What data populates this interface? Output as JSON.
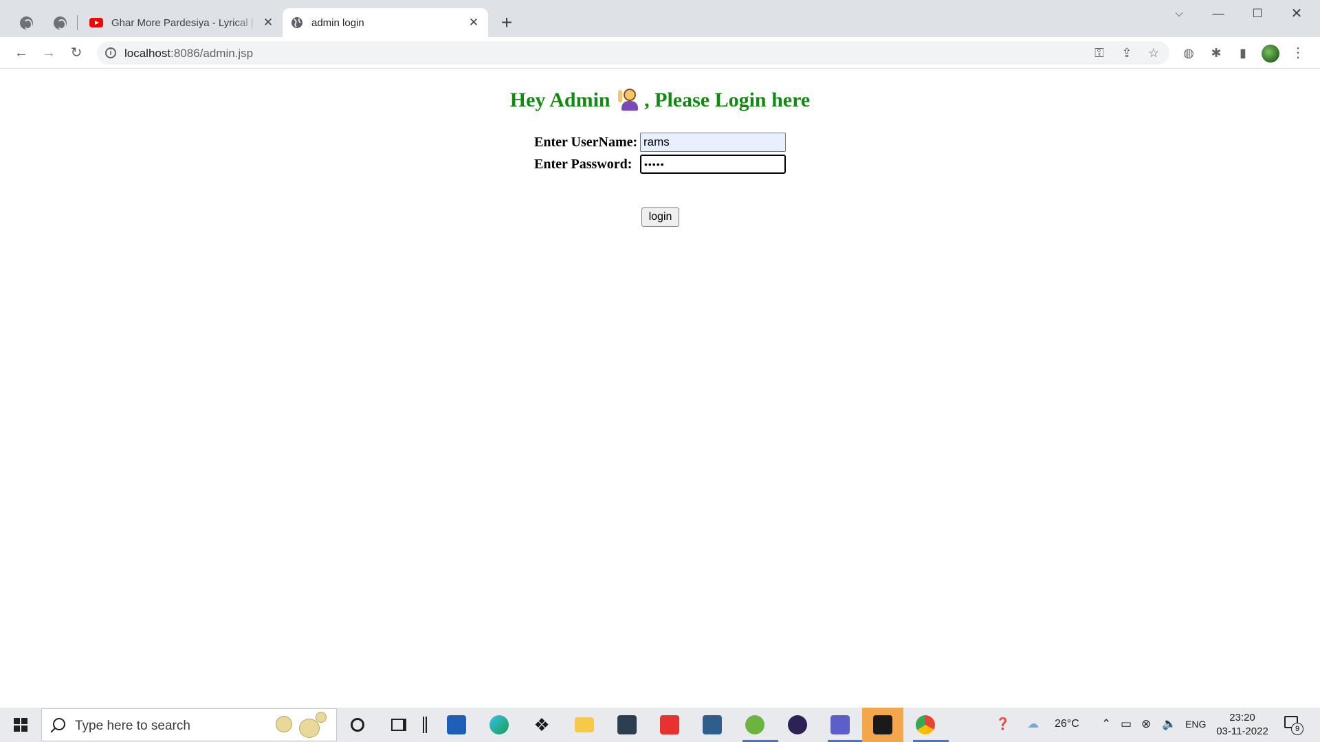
{
  "browser": {
    "tabs": [
      {
        "title": "Ghar More Pardesiya - Lyrical | Ka",
        "icon": "youtube-icon"
      },
      {
        "title": "admin login",
        "icon": "globe-icon"
      }
    ],
    "url_host": "localhost",
    "url_rest": ":8086/admin.jsp"
  },
  "page": {
    "heading_left": "Hey Admin",
    "heading_right": ", Please Login here",
    "username_label": "Enter UserName:",
    "username_value": "rams",
    "password_label": "Enter Password:",
    "password_value": "•••••",
    "login_button": "login"
  },
  "taskbar": {
    "search_placeholder": "Type here to search",
    "weather": "26°C",
    "language": "ENG",
    "time": "23:20",
    "date": "03-11-2022",
    "notification_count": "9"
  },
  "colors": {
    "heading": "#128a12",
    "tabstrip": "#dee1e6",
    "taskbar": "#e8eaed"
  }
}
